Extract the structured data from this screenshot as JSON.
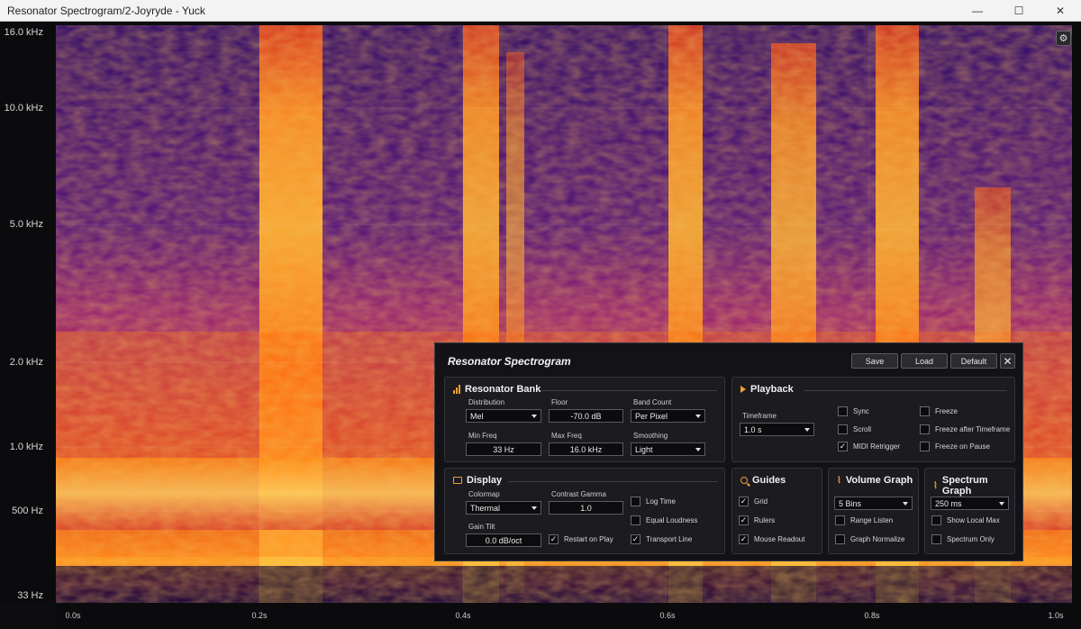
{
  "window": {
    "title": "Resonator Spectrogram/2-Joyryde - Yuck"
  },
  "titlebar_buttons": {
    "minimize": "—",
    "maximize": "☐",
    "close": "✕"
  },
  "y_axis": {
    "labels": [
      "16.0 kHz",
      "10.0 kHz",
      "5.0 kHz",
      "2.0 kHz",
      "1.0 kHz",
      "500 Hz",
      "33 Hz"
    ]
  },
  "x_axis": {
    "labels": [
      "0.0s",
      "0.2s",
      "0.4s",
      "0.6s",
      "0.8s",
      "1.0s"
    ]
  },
  "gear_button": {
    "icon": "gear-icon",
    "glyph": "⚙"
  },
  "colors": {
    "accent": "#f0a030",
    "colormap": [
      "#1a0a3a",
      "#4a1a7a",
      "#8a2a8a",
      "#d03030",
      "#ff7a10",
      "#ffd040",
      "#fff4b0"
    ]
  },
  "panel": {
    "title": "Resonator Spectrogram",
    "save": "Save",
    "load": "Load",
    "default": "Default",
    "close": "✕",
    "resonator_bank": {
      "title": "Resonator Bank",
      "distribution_label": "Distribution",
      "distribution": "Mel",
      "floor_label": "Floor",
      "floor": "-70.0 dB",
      "band_count_label": "Band Count",
      "band_count": "Per Pixel",
      "min_freq_label": "Min Freq",
      "min_freq": "33 Hz",
      "max_freq_label": "Max Freq",
      "max_freq": "16.0 kHz",
      "smoothing_label": "Smoothing",
      "smoothing": "Light"
    },
    "playback": {
      "title": "Playback",
      "timeframe_label": "Timeframe",
      "timeframe": "1.0 s",
      "checks": [
        {
          "label": "Sync",
          "checked": false
        },
        {
          "label": "Scroll",
          "checked": false
        },
        {
          "label": "MIDI Retrigger",
          "checked": true
        },
        {
          "label": "Freeze",
          "checked": false
        },
        {
          "label": "Freeze after Timeframe",
          "checked": false
        },
        {
          "label": "Freeze on Pause",
          "checked": false
        }
      ]
    },
    "display": {
      "title": "Display",
      "colormap_label": "Colormap",
      "colormap": "Thermal",
      "contrast_label": "Contrast Gamma",
      "contrast": "1.0",
      "gain_tilt_label": "Gain Tilt",
      "gain_tilt": "0.0 dB/oct",
      "checks": [
        {
          "label": "Restart on Play",
          "checked": true
        },
        {
          "label": "Log Time",
          "checked": false
        },
        {
          "label": "Equal Loudness",
          "checked": false
        },
        {
          "label": "Transport Line",
          "checked": true
        }
      ]
    },
    "guides": {
      "title": "Guides",
      "checks": [
        {
          "label": "Grid",
          "checked": true
        },
        {
          "label": "Rulers",
          "checked": true
        },
        {
          "label": "Mouse Readout",
          "checked": true
        }
      ]
    },
    "volume_graph": {
      "title": "Volume Graph",
      "bins": "5 Bins",
      "checks": [
        {
          "label": "Range Listen",
          "checked": false
        },
        {
          "label": "Graph Normalize",
          "checked": false
        }
      ]
    },
    "spectrum_graph": {
      "title": "Spectrum Graph",
      "window": "250 ms",
      "checks": [
        {
          "label": "Show Local Max",
          "checked": false
        },
        {
          "label": "Spectrum Only",
          "checked": false
        }
      ]
    }
  }
}
